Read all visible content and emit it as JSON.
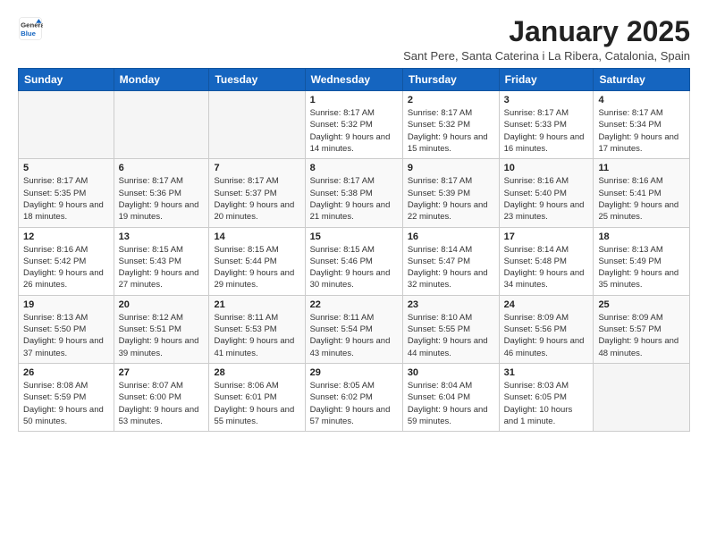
{
  "logo": {
    "line1": "General",
    "line2": "Blue"
  },
  "title": "January 2025",
  "subtitle": "Sant Pere, Santa Caterina i La Ribera, Catalonia, Spain",
  "headers": [
    "Sunday",
    "Monday",
    "Tuesday",
    "Wednesday",
    "Thursday",
    "Friday",
    "Saturday"
  ],
  "weeks": [
    [
      {
        "day": "",
        "sunrise": "",
        "sunset": "",
        "daylight": ""
      },
      {
        "day": "",
        "sunrise": "",
        "sunset": "",
        "daylight": ""
      },
      {
        "day": "",
        "sunrise": "",
        "sunset": "",
        "daylight": ""
      },
      {
        "day": "1",
        "sunrise": "Sunrise: 8:17 AM",
        "sunset": "Sunset: 5:32 PM",
        "daylight": "Daylight: 9 hours and 14 minutes."
      },
      {
        "day": "2",
        "sunrise": "Sunrise: 8:17 AM",
        "sunset": "Sunset: 5:32 PM",
        "daylight": "Daylight: 9 hours and 15 minutes."
      },
      {
        "day": "3",
        "sunrise": "Sunrise: 8:17 AM",
        "sunset": "Sunset: 5:33 PM",
        "daylight": "Daylight: 9 hours and 16 minutes."
      },
      {
        "day": "4",
        "sunrise": "Sunrise: 8:17 AM",
        "sunset": "Sunset: 5:34 PM",
        "daylight": "Daylight: 9 hours and 17 minutes."
      }
    ],
    [
      {
        "day": "5",
        "sunrise": "Sunrise: 8:17 AM",
        "sunset": "Sunset: 5:35 PM",
        "daylight": "Daylight: 9 hours and 18 minutes."
      },
      {
        "day": "6",
        "sunrise": "Sunrise: 8:17 AM",
        "sunset": "Sunset: 5:36 PM",
        "daylight": "Daylight: 9 hours and 19 minutes."
      },
      {
        "day": "7",
        "sunrise": "Sunrise: 8:17 AM",
        "sunset": "Sunset: 5:37 PM",
        "daylight": "Daylight: 9 hours and 20 minutes."
      },
      {
        "day": "8",
        "sunrise": "Sunrise: 8:17 AM",
        "sunset": "Sunset: 5:38 PM",
        "daylight": "Daylight: 9 hours and 21 minutes."
      },
      {
        "day": "9",
        "sunrise": "Sunrise: 8:17 AM",
        "sunset": "Sunset: 5:39 PM",
        "daylight": "Daylight: 9 hours and 22 minutes."
      },
      {
        "day": "10",
        "sunrise": "Sunrise: 8:16 AM",
        "sunset": "Sunset: 5:40 PM",
        "daylight": "Daylight: 9 hours and 23 minutes."
      },
      {
        "day": "11",
        "sunrise": "Sunrise: 8:16 AM",
        "sunset": "Sunset: 5:41 PM",
        "daylight": "Daylight: 9 hours and 25 minutes."
      }
    ],
    [
      {
        "day": "12",
        "sunrise": "Sunrise: 8:16 AM",
        "sunset": "Sunset: 5:42 PM",
        "daylight": "Daylight: 9 hours and 26 minutes."
      },
      {
        "day": "13",
        "sunrise": "Sunrise: 8:15 AM",
        "sunset": "Sunset: 5:43 PM",
        "daylight": "Daylight: 9 hours and 27 minutes."
      },
      {
        "day": "14",
        "sunrise": "Sunrise: 8:15 AM",
        "sunset": "Sunset: 5:44 PM",
        "daylight": "Daylight: 9 hours and 29 minutes."
      },
      {
        "day": "15",
        "sunrise": "Sunrise: 8:15 AM",
        "sunset": "Sunset: 5:46 PM",
        "daylight": "Daylight: 9 hours and 30 minutes."
      },
      {
        "day": "16",
        "sunrise": "Sunrise: 8:14 AM",
        "sunset": "Sunset: 5:47 PM",
        "daylight": "Daylight: 9 hours and 32 minutes."
      },
      {
        "day": "17",
        "sunrise": "Sunrise: 8:14 AM",
        "sunset": "Sunset: 5:48 PM",
        "daylight": "Daylight: 9 hours and 34 minutes."
      },
      {
        "day": "18",
        "sunrise": "Sunrise: 8:13 AM",
        "sunset": "Sunset: 5:49 PM",
        "daylight": "Daylight: 9 hours and 35 minutes."
      }
    ],
    [
      {
        "day": "19",
        "sunrise": "Sunrise: 8:13 AM",
        "sunset": "Sunset: 5:50 PM",
        "daylight": "Daylight: 9 hours and 37 minutes."
      },
      {
        "day": "20",
        "sunrise": "Sunrise: 8:12 AM",
        "sunset": "Sunset: 5:51 PM",
        "daylight": "Daylight: 9 hours and 39 minutes."
      },
      {
        "day": "21",
        "sunrise": "Sunrise: 8:11 AM",
        "sunset": "Sunset: 5:53 PM",
        "daylight": "Daylight: 9 hours and 41 minutes."
      },
      {
        "day": "22",
        "sunrise": "Sunrise: 8:11 AM",
        "sunset": "Sunset: 5:54 PM",
        "daylight": "Daylight: 9 hours and 43 minutes."
      },
      {
        "day": "23",
        "sunrise": "Sunrise: 8:10 AM",
        "sunset": "Sunset: 5:55 PM",
        "daylight": "Daylight: 9 hours and 44 minutes."
      },
      {
        "day": "24",
        "sunrise": "Sunrise: 8:09 AM",
        "sunset": "Sunset: 5:56 PM",
        "daylight": "Daylight: 9 hours and 46 minutes."
      },
      {
        "day": "25",
        "sunrise": "Sunrise: 8:09 AM",
        "sunset": "Sunset: 5:57 PM",
        "daylight": "Daylight: 9 hours and 48 minutes."
      }
    ],
    [
      {
        "day": "26",
        "sunrise": "Sunrise: 8:08 AM",
        "sunset": "Sunset: 5:59 PM",
        "daylight": "Daylight: 9 hours and 50 minutes."
      },
      {
        "day": "27",
        "sunrise": "Sunrise: 8:07 AM",
        "sunset": "Sunset: 6:00 PM",
        "daylight": "Daylight: 9 hours and 53 minutes."
      },
      {
        "day": "28",
        "sunrise": "Sunrise: 8:06 AM",
        "sunset": "Sunset: 6:01 PM",
        "daylight": "Daylight: 9 hours and 55 minutes."
      },
      {
        "day": "29",
        "sunrise": "Sunrise: 8:05 AM",
        "sunset": "Sunset: 6:02 PM",
        "daylight": "Daylight: 9 hours and 57 minutes."
      },
      {
        "day": "30",
        "sunrise": "Sunrise: 8:04 AM",
        "sunset": "Sunset: 6:04 PM",
        "daylight": "Daylight: 9 hours and 59 minutes."
      },
      {
        "day": "31",
        "sunrise": "Sunrise: 8:03 AM",
        "sunset": "Sunset: 6:05 PM",
        "daylight": "Daylight: 10 hours and 1 minute."
      },
      {
        "day": "",
        "sunrise": "",
        "sunset": "",
        "daylight": ""
      }
    ]
  ]
}
